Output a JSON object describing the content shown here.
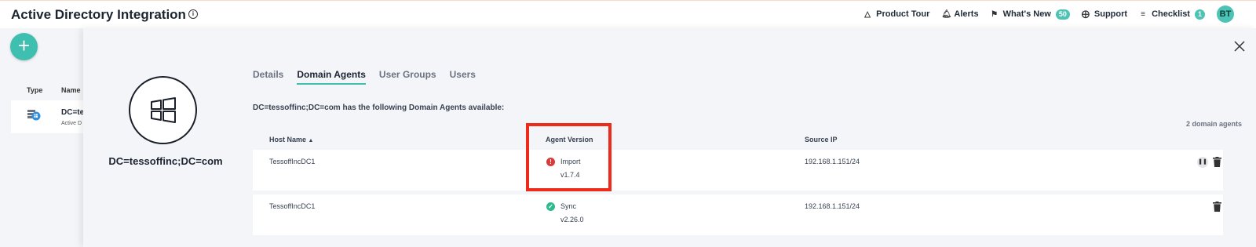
{
  "app": {
    "title": "Active Directory Integration"
  },
  "topnav": {
    "product_tour": "Product Tour",
    "alerts": "Alerts",
    "whats_new": "What's New",
    "whats_new_count": "50",
    "support": "Support",
    "checklist": "Checklist",
    "checklist_count": "1",
    "avatar_initials": "BT"
  },
  "background": {
    "fab_label": "+",
    "col_type": "Type",
    "col_name": "Name",
    "row_name": "DC=te",
    "row_sub": "Active D"
  },
  "panel": {
    "dc_name": "DC=tessoffinc;DC=com",
    "tabs": [
      {
        "label": "Details",
        "active": false
      },
      {
        "label": "Domain Agents",
        "active": true
      },
      {
        "label": "User Groups",
        "active": false
      },
      {
        "label": "Users",
        "active": false
      }
    ],
    "summary": "DC=tessoffinc;DC=com has the following Domain Agents available:",
    "count_label": "2 domain agents",
    "columns": {
      "host": "Host Name",
      "version": "Agent Version",
      "source": "Source IP"
    },
    "rows": [
      {
        "host": "TessoffIncDC1",
        "status": "Import",
        "version": "v1.7.4",
        "status_type": "error",
        "source": "192.168.1.151/24"
      },
      {
        "host": "TessoffIncDC1",
        "status": "Sync",
        "version": "v2.26.0",
        "status_type": "ok",
        "source": "192.168.1.151/24"
      }
    ]
  },
  "colors": {
    "accent": "#3fbfb0",
    "error": "#d93a3a",
    "ok": "#2fb98e",
    "highlight": "#ee2a1b"
  }
}
